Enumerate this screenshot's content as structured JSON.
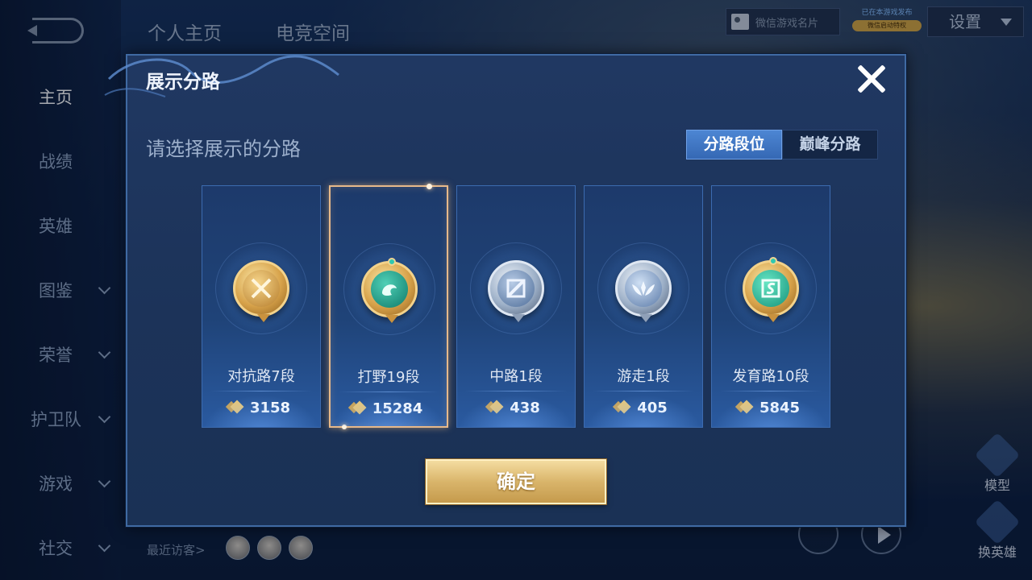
{
  "sidebar": {
    "items": [
      {
        "label": "主页",
        "active": true
      },
      {
        "label": "战绩"
      },
      {
        "label": "英雄"
      },
      {
        "label": "图鉴"
      },
      {
        "label": "荣誉"
      },
      {
        "label": "护卫队"
      },
      {
        "label": "游戏"
      },
      {
        "label": "社交"
      }
    ]
  },
  "top": {
    "tabs": [
      "个人主页",
      "电竞空间"
    ],
    "card_label": "微信游戏名片",
    "badge_line": "已在本游戏发布",
    "badge_pill": "微信启动特权",
    "settings_label": "设置"
  },
  "bottom": {
    "visitors_label": "最近访客>",
    "right_buttons": [
      "模型",
      "换英雄"
    ]
  },
  "modal": {
    "title": "展示分路",
    "subtitle": "请选择展示的分路",
    "segments": {
      "active": "分路段位",
      "inactive": "巅峰分路"
    },
    "lanes": [
      {
        "name": "对抗路7段",
        "points": "3158",
        "medal": "gold",
        "selected": false
      },
      {
        "name": "打野19段",
        "points": "15284",
        "medal": "gold",
        "selected": true
      },
      {
        "name": "中路1段",
        "points": "438",
        "medal": "silver",
        "selected": false
      },
      {
        "name": "游走1段",
        "points": "405",
        "medal": "silver",
        "selected": false
      },
      {
        "name": "发育路10段",
        "points": "5845",
        "medal": "gold",
        "selected": false
      }
    ],
    "confirm_label": "确定"
  },
  "colors": {
    "accent_blue": "#3568b4",
    "gold": "#d9b56b",
    "selected_border": "#e7b98a"
  }
}
